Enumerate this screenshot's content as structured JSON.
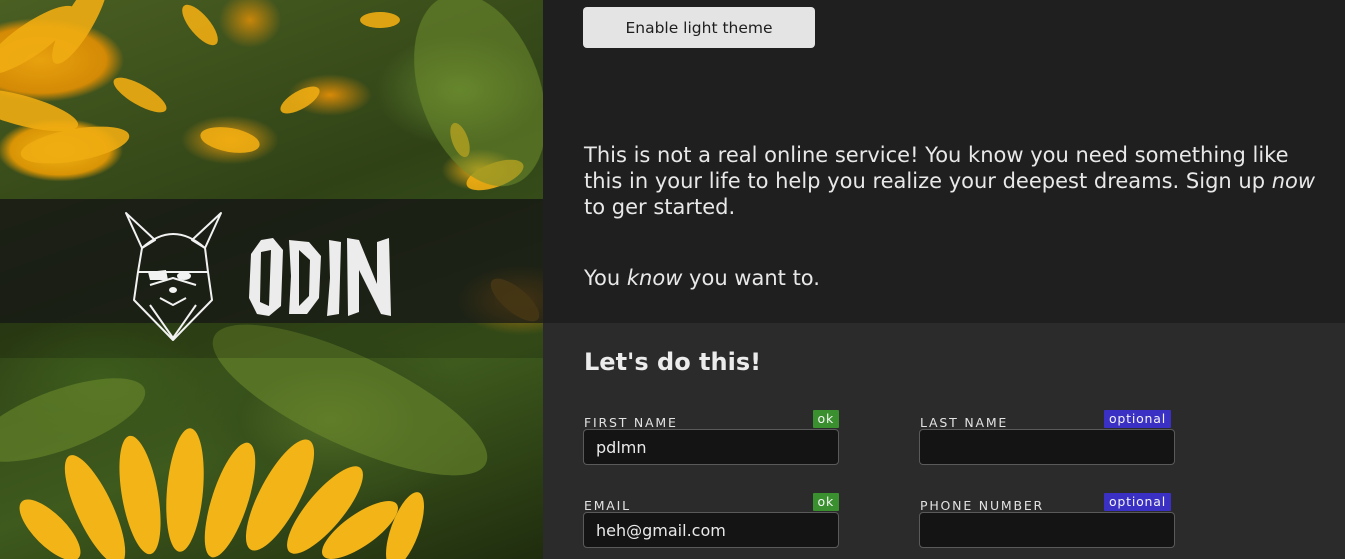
{
  "brand": {
    "name": "ODIN"
  },
  "header": {
    "theme_button_label": "Enable light theme"
  },
  "intro": {
    "p1_before": "This is not a real online service! You know you need something like this in your life to help you realize your deepest dreams. Sign up ",
    "p1_emphasis": "now",
    "p1_after": " to ger started.",
    "p2_before": "You ",
    "p2_emphasis": "know",
    "p2_after": " you want to."
  },
  "form": {
    "title": "Let's do this!",
    "fields": [
      {
        "label": "FIRST NAME",
        "value": "pdlmn",
        "badge": "ok",
        "badge_type": "ok"
      },
      {
        "label": "LAST NAME",
        "value": "",
        "badge": "optional",
        "badge_type": "optional"
      },
      {
        "label": "EMAIL",
        "value": "heh@gmail.com",
        "badge": "ok",
        "badge_type": "ok"
      },
      {
        "label": "PHONE NUMBER",
        "value": "",
        "badge": "optional",
        "badge_type": "optional"
      }
    ]
  },
  "colors": {
    "page_bg": "#1f1f1f",
    "form_bg": "#2b2b2b",
    "ok_badge": "#3a8f2f",
    "optional_badge": "#3a31c4",
    "input_bg": "#141414"
  }
}
